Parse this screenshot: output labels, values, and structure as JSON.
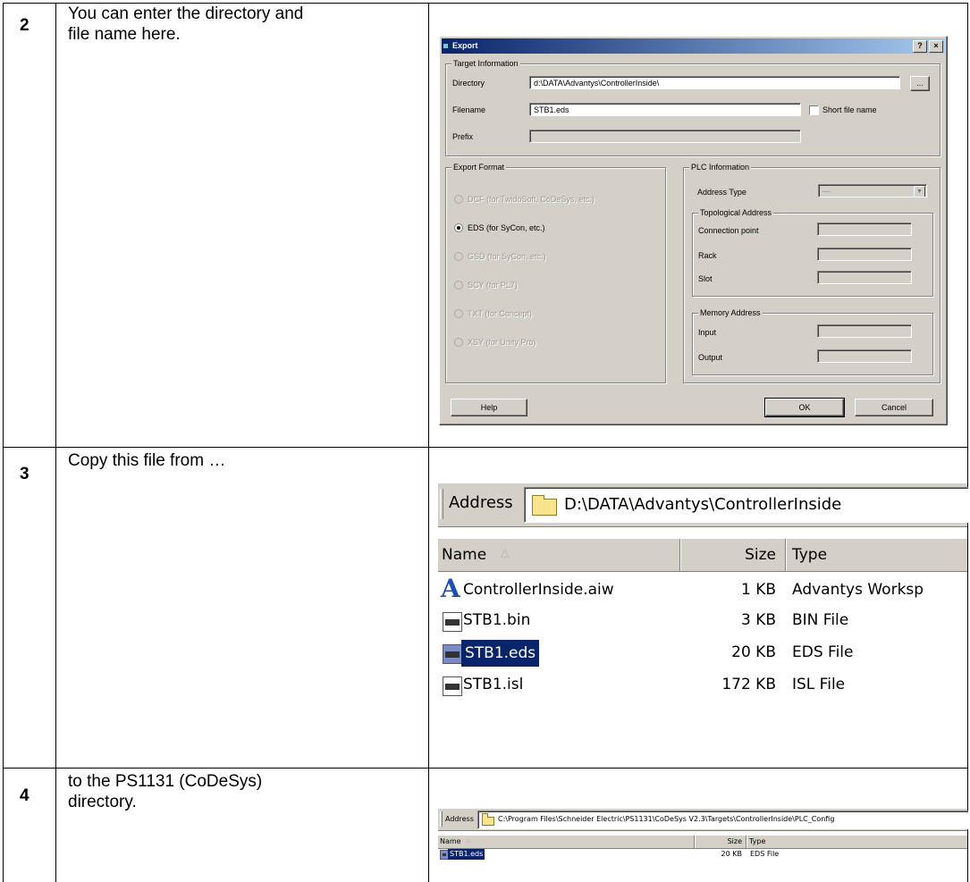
{
  "steps": [
    {
      "number": "2",
      "text": "You can enter the directory and\nfile name here."
    },
    {
      "number": "3",
      "text": "Copy this file from …"
    },
    {
      "number": "4",
      "text": "to the PS1131 (CoDeSys)\ndirectory."
    }
  ],
  "export_dialog": {
    "title": "Export",
    "title_buttons": {
      "help": "?",
      "close": "×"
    },
    "target_group": "Target Information",
    "directory_label": "Directory",
    "directory_value": "d:\\DATA\\Advantys\\ControllerInside\\",
    "browse_label": "...",
    "filename_label": "Filename",
    "filename_value": "STB1.eds",
    "short_name_label": "Short file name",
    "prefix_label": "Prefix",
    "prefix_value": "",
    "format_group": "Export Format",
    "formats": [
      {
        "label": "DCF (for TwidoSoft, CoDeSys, etc.)",
        "enabled": false,
        "selected": false
      },
      {
        "label": "EDS (for SyCon, etc.)",
        "enabled": true,
        "selected": true
      },
      {
        "label": "GSD (for SyCon, etc.)",
        "enabled": false,
        "selected": false
      },
      {
        "label": "SCY (for PL7)",
        "enabled": false,
        "selected": false
      },
      {
        "label": "TXT (for Concept)",
        "enabled": false,
        "selected": false
      },
      {
        "label": "XSY (for Unity Pro)",
        "enabled": false,
        "selected": false
      }
    ],
    "plc_group": "PLC Information",
    "address_type_label": "Address Type",
    "address_type_value": "---",
    "topo_group": "Topological Address",
    "connection_point_label": "Connection point",
    "rack_label": "Rack",
    "slot_label": "Slot",
    "memory_group": "Memory Address",
    "input_label": "Input",
    "output_label": "Output",
    "help_button": "Help",
    "ok_button": "OK",
    "cancel_button": "Cancel"
  },
  "explorer_large": {
    "address_label": "Address",
    "address_path": "D:\\DATA\\Advantys\\ControllerInside",
    "columns": {
      "name": "Name",
      "sort_indicator": "△",
      "size": "Size",
      "type": "Type"
    },
    "files": [
      {
        "name": "ControllerInside.aiw",
        "size": "1 KB",
        "type": "Advantys Worksp",
        "icon": "advantys-icon",
        "selected": false
      },
      {
        "name": "STB1.bin",
        "size": "3 KB",
        "type": "BIN File",
        "icon": "file-icon",
        "selected": false
      },
      {
        "name": "STB1.eds",
        "size": "20 KB",
        "type": "EDS File",
        "icon": "file-icon",
        "selected": true
      },
      {
        "name": "STB1.isl",
        "size": "172 KB",
        "type": "ISL File",
        "icon": "file-icon",
        "selected": false
      }
    ]
  },
  "explorer_small": {
    "address_label": "Address",
    "address_path": "C:\\Program Files\\Schneider Electric\\PS1131\\CoDeSys V2.3\\Targets\\ControllerInside\\PLC_Config",
    "columns": {
      "name": "Name",
      "sort_indicator": "△",
      "size": "Size",
      "type": "Type"
    },
    "files": [
      {
        "name": "STB1.eds",
        "size": "20 KB",
        "type": "EDS File",
        "icon": "file-icon",
        "selected": true
      }
    ]
  },
  "colors": {
    "titlebar_start": "#0a246a",
    "titlebar_end": "#a6caf0",
    "dialog_face": "#d4d0c8",
    "selection": "#0a246a"
  }
}
